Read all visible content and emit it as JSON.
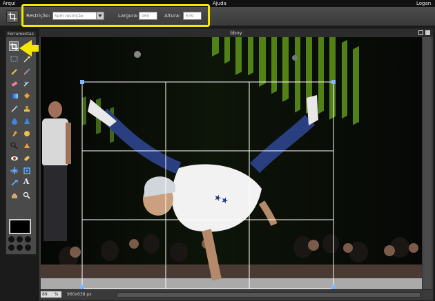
{
  "menubar": {
    "left_label": "Arqui",
    "right_help": "Ajuda",
    "login": "Logan"
  },
  "options": {
    "restriction_label": "Restrição:",
    "restriction_value": "Sem restrição",
    "width_label": "Largura:",
    "width_value": "960",
    "height_label": "Altura:",
    "height_value": "639"
  },
  "tools_panel": {
    "title": "Ferramentas"
  },
  "tools": [
    "crop-tool",
    "lasso-tool",
    "marquee-tool",
    "magic-wand-tool",
    "pencil-tool",
    "brush-tool",
    "eraser-tool",
    "replace-color-tool",
    "gradient-tool",
    "paint-bucket-tool",
    "color-picker-tool",
    "clone-stamp-tool",
    "blur-tool",
    "sharpen-tool",
    "smudge-tool",
    "sponge-tool",
    "dodge-tool",
    "burn-tool",
    "redeye-tool",
    "spot-heal-tool",
    "bloat-tool",
    "pinch-tool",
    "move-tool",
    "type-tool",
    "hand-tool",
    "zoom-tool"
  ],
  "document": {
    "title": "bboy",
    "zoom": "89",
    "zoom_unit": "%",
    "dimensions": "960x638 px"
  },
  "colors": {
    "highlight": "#f5e600",
    "arrow": "#f5e600"
  }
}
